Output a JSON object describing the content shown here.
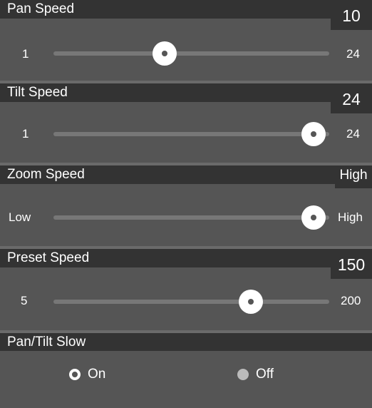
{
  "pan_speed": {
    "title": "Pan Speed",
    "value": "10",
    "min": "1",
    "max": "24",
    "level": 10
  },
  "tilt_speed": {
    "title": "Tilt Speed",
    "value": "24",
    "min": "1",
    "max": "24",
    "level": 24
  },
  "zoom_speed": {
    "title": "Zoom Speed",
    "value": "High",
    "min": "Low",
    "max": "High",
    "level_fraction": 1.0
  },
  "preset_speed": {
    "title": "Preset Speed",
    "value": "150",
    "min": "5",
    "max": "200",
    "level": 150
  },
  "pan_tilt_slow": {
    "title": "Pan/Tilt Slow",
    "options": [
      {
        "label": "On",
        "selected": true
      },
      {
        "label": "Off",
        "selected": false
      }
    ]
  },
  "colors": {
    "panel": "#555555",
    "header": "#333333",
    "track": "#777777",
    "thumb": "#ffffff"
  }
}
